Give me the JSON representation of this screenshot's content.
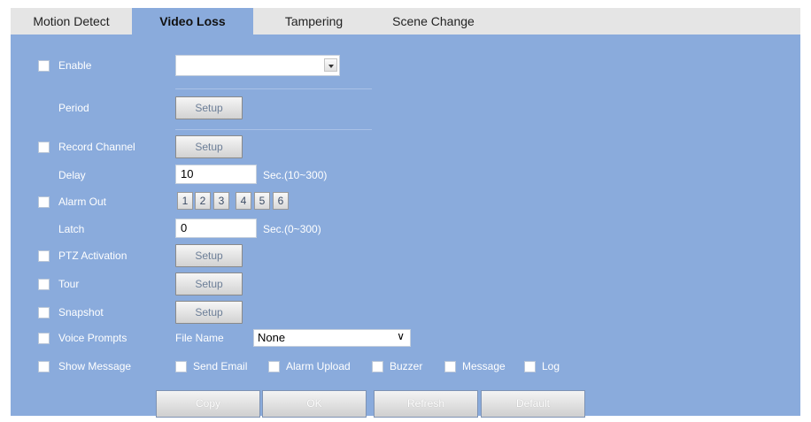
{
  "tabs": [
    {
      "label": "Motion Detect"
    },
    {
      "label": "Video Loss"
    },
    {
      "label": "Tampering"
    },
    {
      "label": "Scene Change"
    }
  ],
  "enable": {
    "label": "Enable",
    "checked": false,
    "dropdown_value": ""
  },
  "period": {
    "label": "Period",
    "button": "Setup"
  },
  "record_channel": {
    "label": "Record Channel",
    "button": "Setup"
  },
  "delay": {
    "label": "Delay",
    "value": "10",
    "unit": "Sec.(10~300)"
  },
  "alarm_out": {
    "label": "Alarm Out",
    "channels": [
      "1",
      "2",
      "3",
      "4",
      "5",
      "6"
    ]
  },
  "latch": {
    "label": "Latch",
    "value": "0",
    "unit": "Sec.(0~300)"
  },
  "ptz_activation": {
    "label": "PTZ Activation",
    "button": "Setup"
  },
  "tour": {
    "label": "Tour",
    "button": "Setup"
  },
  "snapshot": {
    "label": "Snapshot",
    "button": "Setup"
  },
  "voice_prompts": {
    "label": "Voice Prompts",
    "file_name_label": "File Name",
    "file_value": "None"
  },
  "show_message": {
    "label": "Show Message"
  },
  "options": {
    "send_email": "Send Email",
    "alarm_upload": "Alarm Upload",
    "buzzer": "Buzzer",
    "message": "Message",
    "log": "Log"
  },
  "actions": {
    "copy": "Copy",
    "ok": "OK",
    "refresh": "Refresh",
    "default": "Default"
  },
  "colors": {
    "panel": "#8aabdc",
    "tab_bar": "#e5e5e5",
    "label": "#ffffff"
  }
}
